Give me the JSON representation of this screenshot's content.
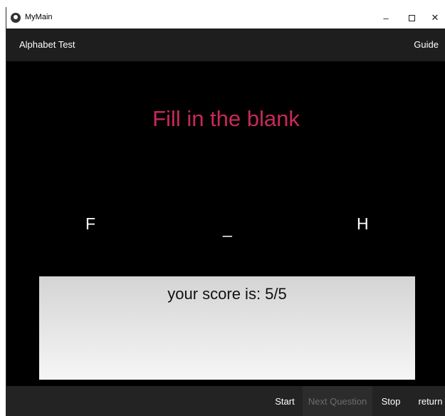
{
  "window": {
    "title": "MyMain",
    "minimize": "–",
    "close": "✕"
  },
  "header": {
    "title": "Alphabet Test",
    "guide_label": "Guide"
  },
  "main": {
    "heading": "Fill in the blank",
    "letters": [
      "F",
      "_",
      "H"
    ],
    "score_text": "your score is: 5/5"
  },
  "footer": {
    "start_label": "Start",
    "next_label": "Next Question",
    "stop_label": "Stop",
    "return_label": "return"
  },
  "colors": {
    "heading": "#c9295a",
    "background": "#000000",
    "bar": "#1e1e1e"
  }
}
